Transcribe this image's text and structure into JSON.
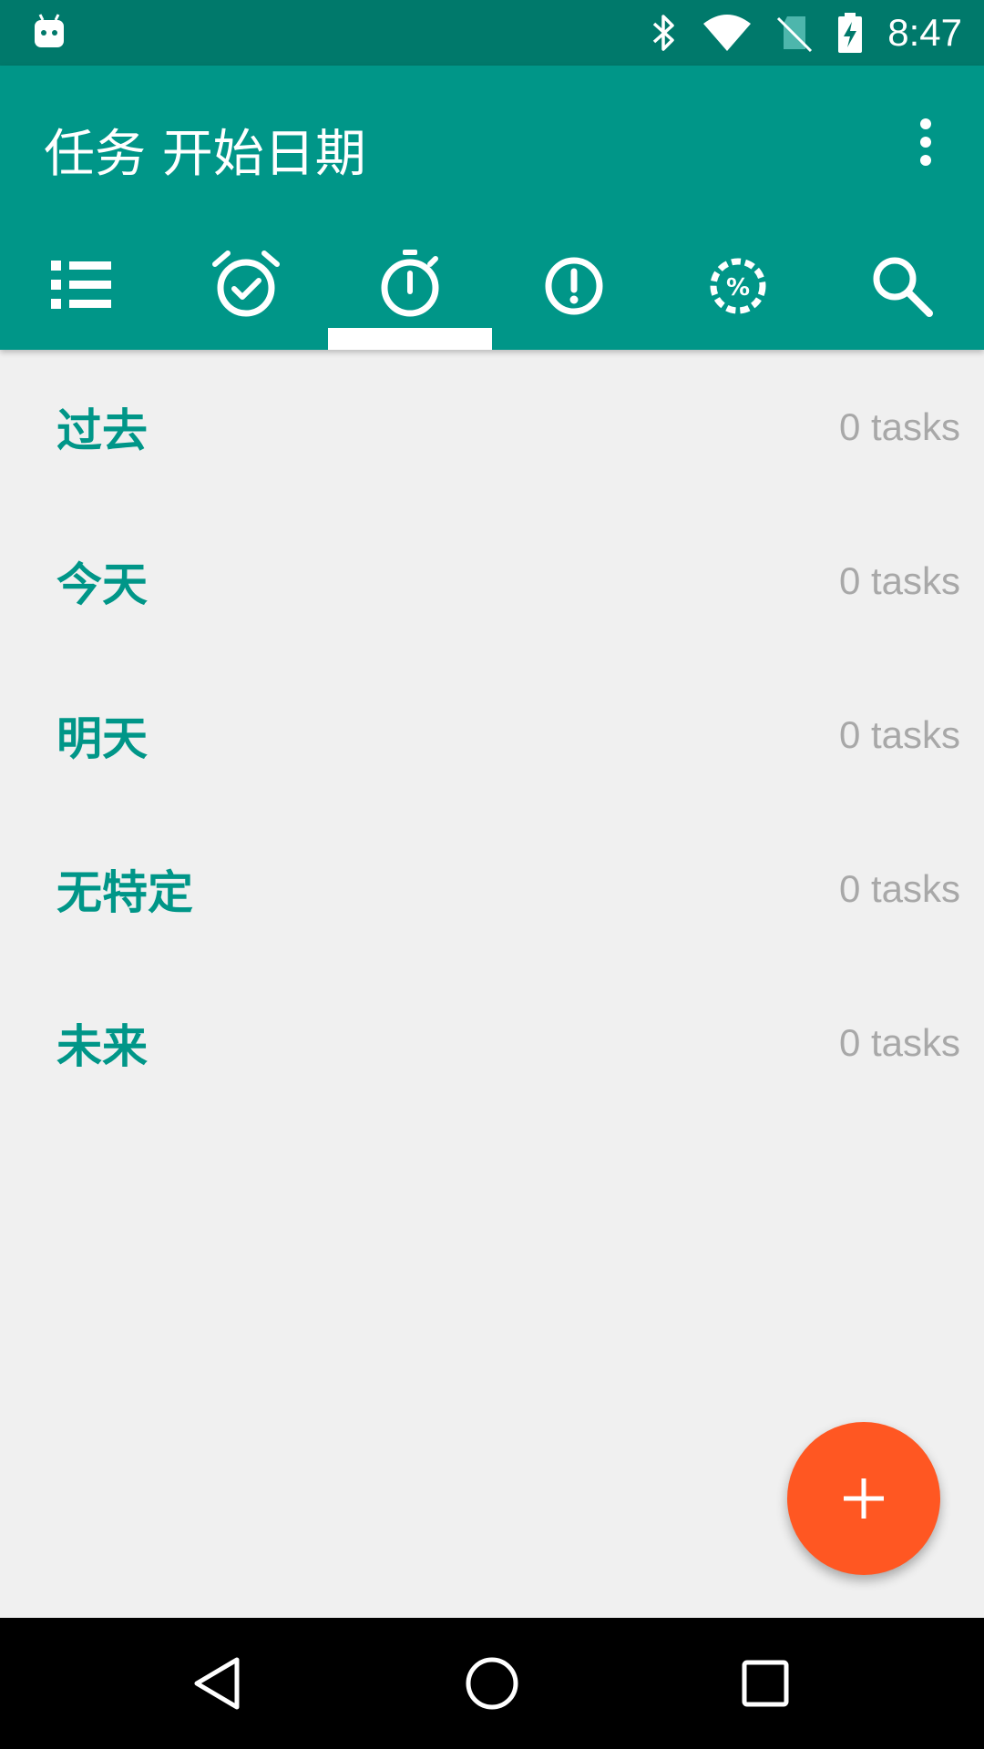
{
  "status_bar": {
    "time": "8:47",
    "icons": [
      "android-icon",
      "bluetooth-icon",
      "wifi-icon",
      "no-sim-icon",
      "battery-charging-icon"
    ]
  },
  "app_bar": {
    "title": "任务 开始日期",
    "overflow_icon": "more-vert-icon"
  },
  "tabs": [
    {
      "icon": "list-icon",
      "active": false
    },
    {
      "icon": "alarm-check-icon",
      "active": false
    },
    {
      "icon": "timer-icon",
      "active": true
    },
    {
      "icon": "priority-icon",
      "active": false
    },
    {
      "icon": "progress-percent-icon",
      "active": false
    },
    {
      "icon": "search-icon",
      "active": false
    }
  ],
  "groups": [
    {
      "label": "过去",
      "count": "0 tasks"
    },
    {
      "label": "今天",
      "count": "0 tasks"
    },
    {
      "label": "明天",
      "count": "0 tasks"
    },
    {
      "label": "无特定",
      "count": "0 tasks"
    },
    {
      "label": "未来",
      "count": "0 tasks"
    }
  ],
  "fab": {
    "icon": "plus-icon"
  },
  "nav_bar": {
    "icons": [
      "back-icon",
      "home-icon",
      "recents-icon"
    ]
  },
  "colors": {
    "primary": "#009688",
    "primary_dark": "#00796b",
    "accent": "#ff5722",
    "background": "#f0f0f0",
    "count_text": "#a8a8a8"
  }
}
